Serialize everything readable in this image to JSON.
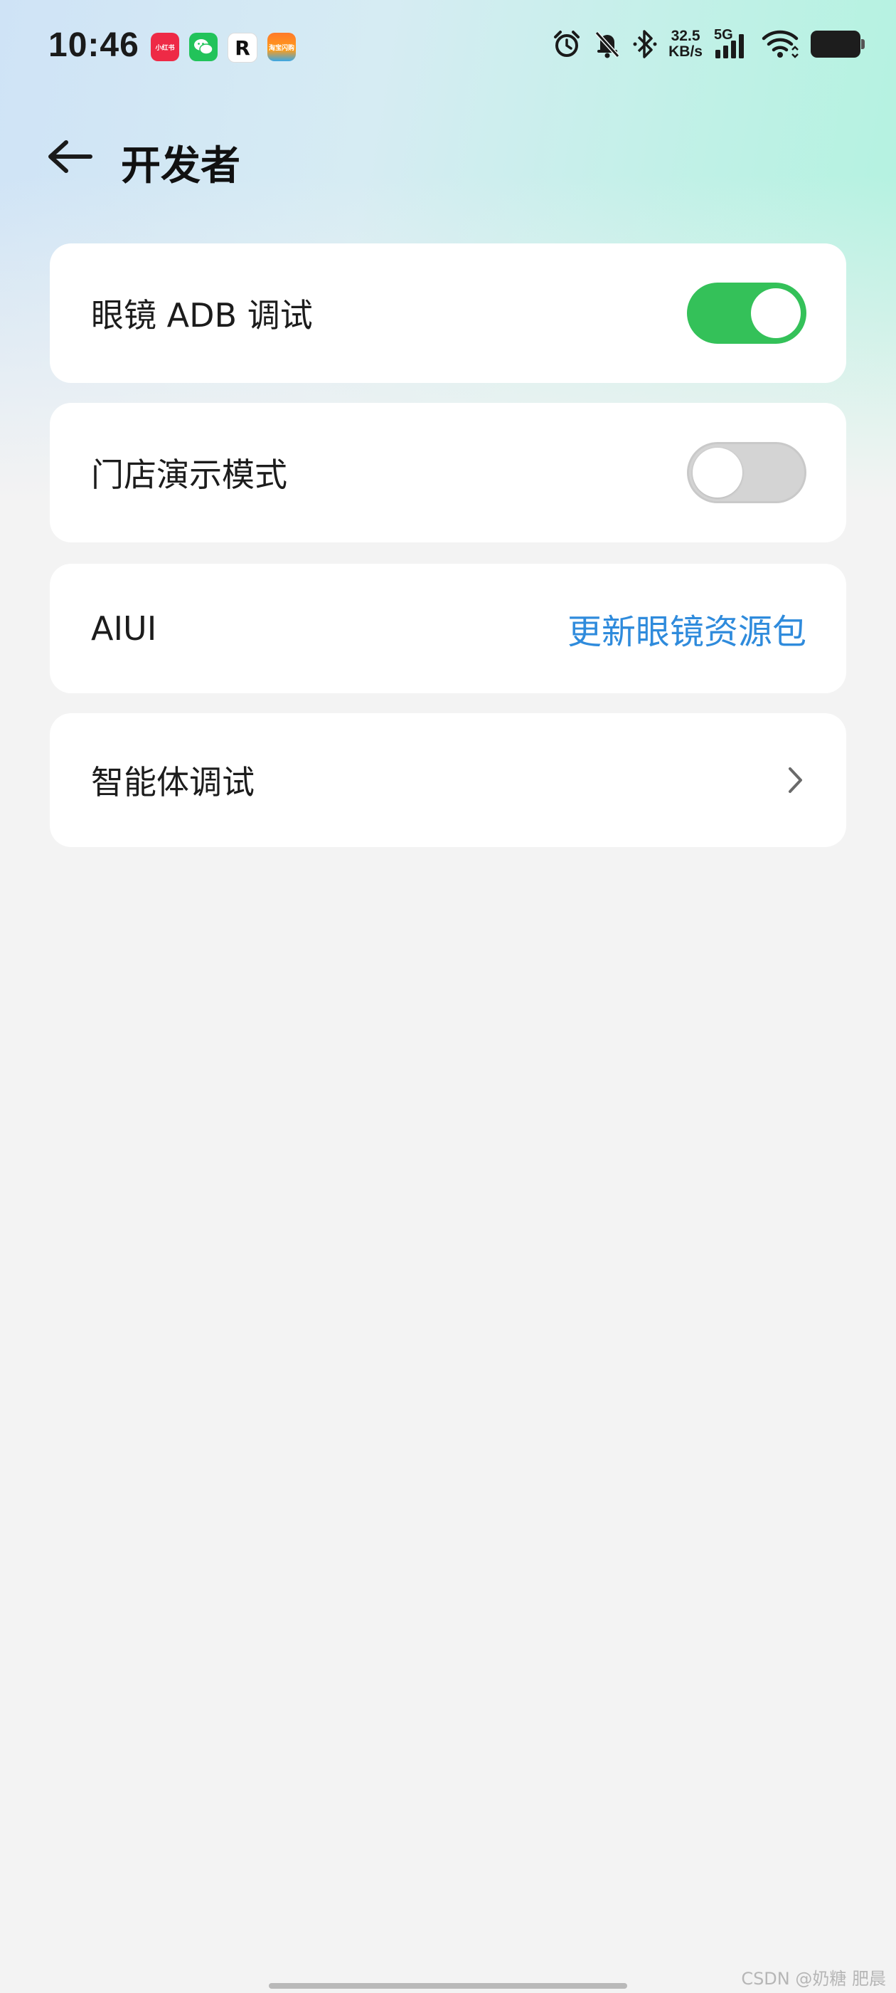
{
  "status_bar": {
    "time": "10:46",
    "notification_apps": [
      {
        "name": "xiaohongshu-icon",
        "label": "小红书"
      },
      {
        "name": "wechat-icon",
        "label": ""
      },
      {
        "name": "r-app-icon",
        "label": "R"
      },
      {
        "name": "taobao-flash-icon",
        "label": "淘宝闪购"
      }
    ],
    "net_speed_value": "32.5",
    "net_speed_unit": "KB/s",
    "network_type": "5G",
    "icons": [
      "alarm-icon",
      "bell-muted-icon",
      "bluetooth-icon",
      "signal-icon",
      "wifi-icon",
      "battery-icon"
    ]
  },
  "header": {
    "back_icon": "arrow-left-icon",
    "title": "开发者"
  },
  "settings": {
    "glasses_adb": {
      "label": "眼镜 ADB 调试",
      "enabled": true
    },
    "store_demo": {
      "label": "门店演示模式",
      "enabled": false
    },
    "aiui": {
      "label": "AIUI",
      "action": "更新眼镜资源包"
    },
    "agent_debug": {
      "label": "智能体调试",
      "icon": "chevron-right-icon"
    }
  },
  "colors": {
    "toggle_on": "#34c159",
    "toggle_off": "#d4d4d4",
    "link": "#2f8bdc",
    "card_bg": "#ffffff",
    "page_bg": "#f3f3f3"
  },
  "watermark": "CSDN @奶糖 肥晨"
}
